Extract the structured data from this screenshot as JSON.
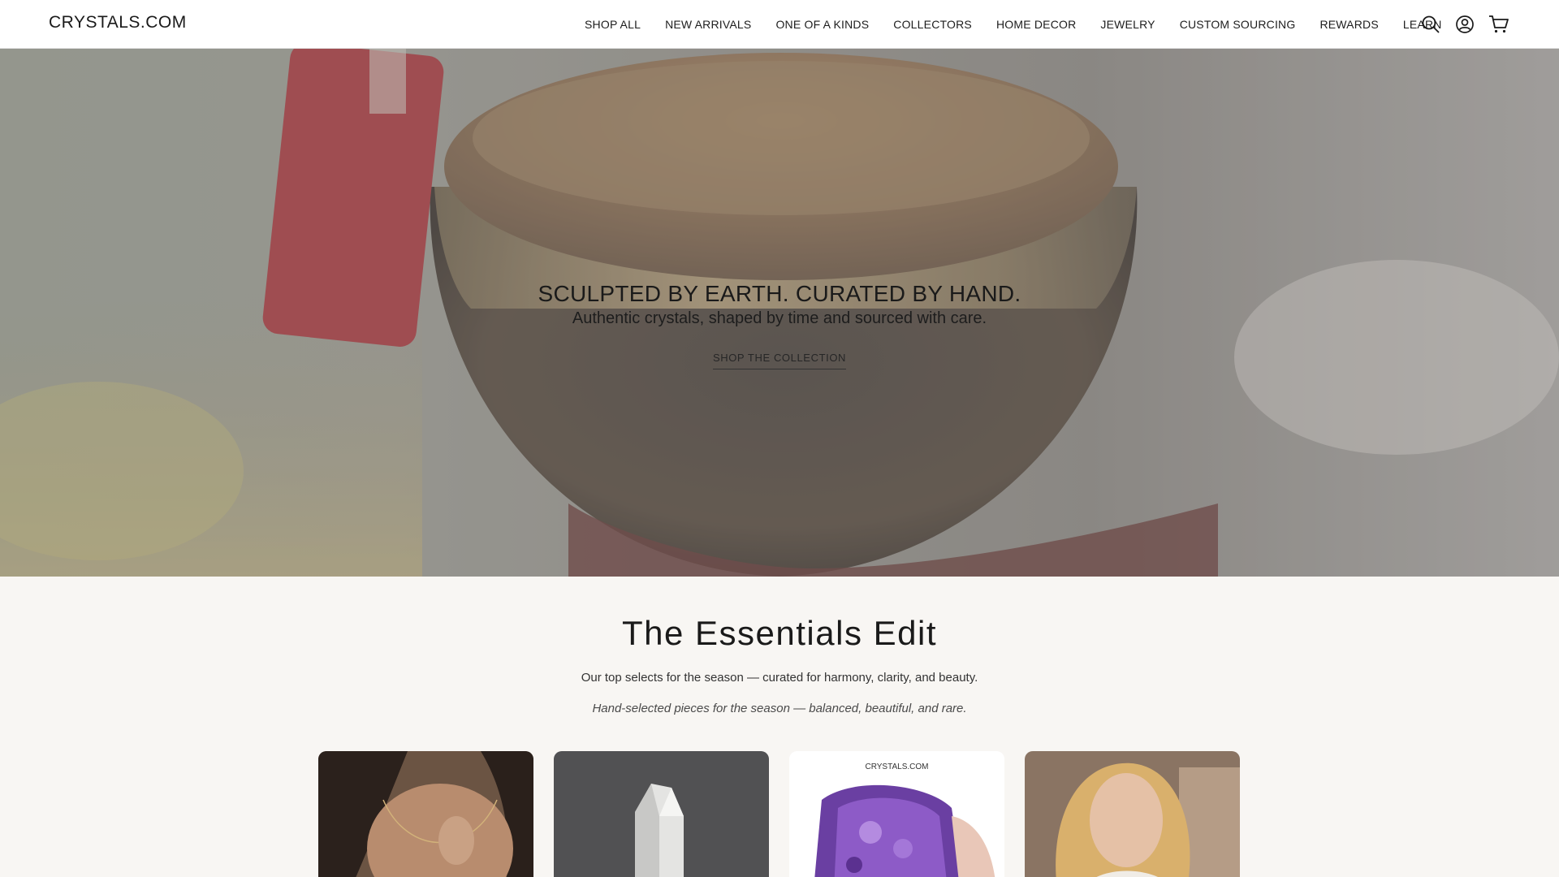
{
  "header": {
    "logo": "CRYSTALS.COM",
    "nav": [
      "SHOP ALL",
      "NEW ARRIVALS",
      "ONE OF A KINDS",
      "COLLECTORS",
      "HOME DECOR",
      "JEWELRY",
      "CUSTOM SOURCING",
      "REWARDS",
      "LEARN"
    ],
    "icons": [
      "search-icon",
      "account-icon",
      "cart-icon"
    ]
  },
  "hero": {
    "title": "SCULPTED BY EARTH. CURATED BY HAND.",
    "subtitle": "Authentic crystals, shaped by time and sourced with care.",
    "cta": "SHOP THE COLLECTION"
  },
  "essentials": {
    "title": "The Essentials Edit",
    "description": "Our top selects for the season — curated for harmony, clarity, and beauty.",
    "tagline": "Hand-selected pieces for the season — balanced, beautiful, and rare.",
    "cards": [
      {
        "image": "necklace-model-photo"
      },
      {
        "image": "clear-quartz-point-photo"
      },
      {
        "image": "amethyst-cluster-photo",
        "label": "CRYSTALS.COM"
      },
      {
        "image": "smiling-woman-photo"
      }
    ]
  },
  "colors": {
    "header_bg": "#ffffff",
    "section_bg": "#f8f6f3",
    "text": "#1a1a1a"
  }
}
